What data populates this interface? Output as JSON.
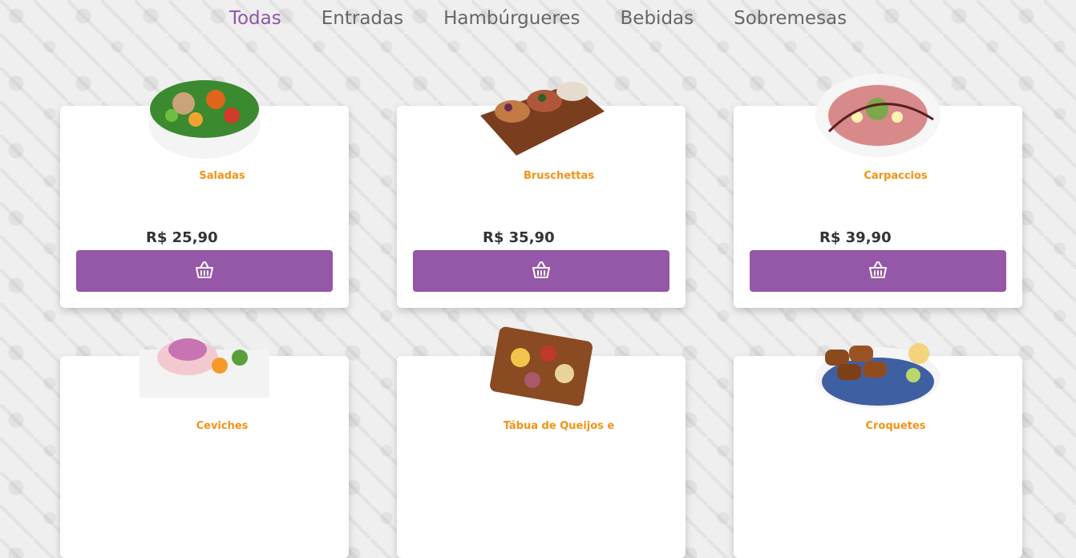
{
  "tabs": [
    {
      "label": "Todas",
      "active": true
    },
    {
      "label": "Entradas",
      "active": false
    },
    {
      "label": "Hambúrgueres",
      "active": false
    },
    {
      "label": "Bebidas",
      "active": false
    },
    {
      "label": "Sobremesas",
      "active": false
    }
  ],
  "products": [
    {
      "title": "Saladas",
      "price": "R$ 25,90",
      "image_icon": "salad-bowl-image"
    },
    {
      "title": "Bruschettas",
      "price": "R$ 35,90",
      "image_icon": "bruschetta-board-image"
    },
    {
      "title": "Carpaccios",
      "price": "R$ 39,90",
      "image_icon": "carpaccio-plate-image"
    },
    {
      "title": "Ceviches",
      "price": "",
      "image_icon": "ceviche-plate-image"
    },
    {
      "title": "Tábua de Queijos e",
      "price": "",
      "image_icon": "cheese-board-image"
    },
    {
      "title": "Croquetes",
      "price": "",
      "image_icon": "croquettes-plate-image"
    }
  ],
  "add_button_icon": "basket-icon",
  "colors": {
    "accent": "#9557a7",
    "title": "#f39214",
    "price": "#333333",
    "nav_active": "#9057a5",
    "nav": "#666666"
  }
}
